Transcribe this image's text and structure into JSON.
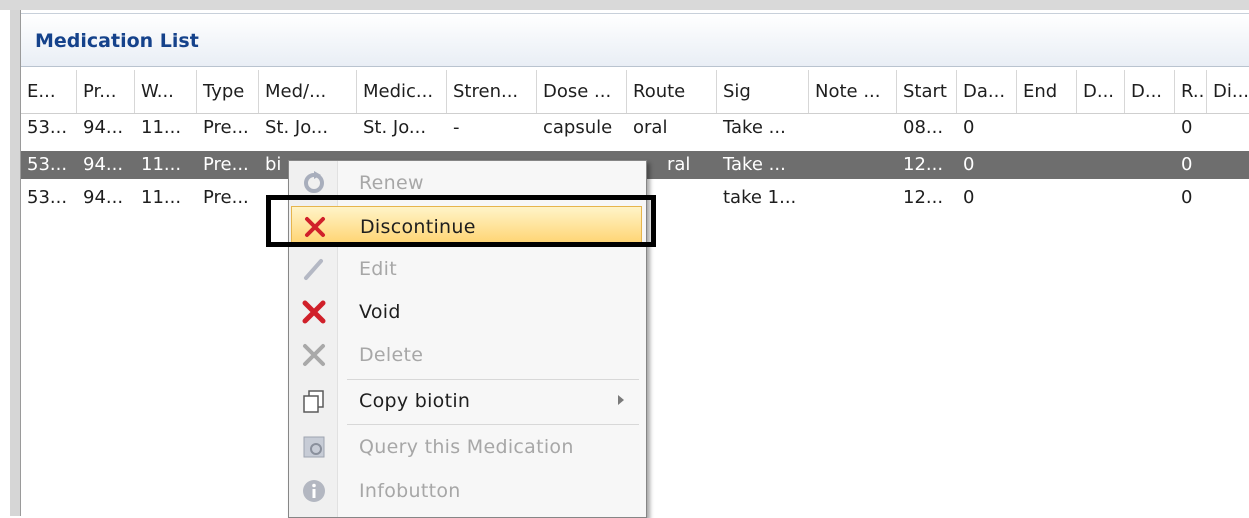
{
  "panel": {
    "title": "Medication List"
  },
  "columns": [
    "E...",
    "Pr...",
    "W...",
    "Type",
    "Med/...",
    "Medic...",
    "Stren...",
    "Dose ...",
    "Route",
    "Sig",
    "Note ...",
    "Start",
    "Da...",
    "End",
    "D...",
    "D...",
    "R..",
    "Di..."
  ],
  "rows": [
    [
      "53...",
      "94...",
      "11...",
      "Pre...",
      "St. Jo...",
      "St. Jo...",
      "-",
      "capsule",
      "oral",
      "Take ...",
      "",
      "08...",
      "0",
      "",
      "",
      "",
      "0",
      ""
    ],
    [
      "53...",
      "94...",
      "11...",
      "Pre...",
      "bi",
      "",
      "",
      "",
      "ral",
      "Take ...",
      "",
      "12...",
      "0",
      "",
      "",
      "",
      "0",
      ""
    ],
    [
      "53...",
      "94...",
      "11...",
      "Pre...",
      "",
      "",
      "",
      "",
      "",
      "take 1...",
      "",
      "12...",
      "0",
      "",
      "",
      "",
      "0",
      ""
    ]
  ],
  "selected_row_index": 1,
  "context_menu": {
    "items": [
      {
        "label": "Renew",
        "icon": "renew-icon",
        "enabled": false
      },
      {
        "label": "Discontinue",
        "icon": "discontinue-x-icon",
        "enabled": true,
        "highlighted": true
      },
      {
        "label": "Edit",
        "icon": "edit-pencil-icon",
        "enabled": false
      },
      {
        "label": "Void",
        "icon": "void-x-icon",
        "enabled": true
      },
      {
        "label": "Delete",
        "icon": "delete-x-icon",
        "enabled": false
      },
      {
        "label": "Copy biotin",
        "icon": "copy-icon",
        "enabled": true,
        "submenu": true
      },
      {
        "label": "Query this Medication",
        "icon": "query-icon",
        "enabled": false
      },
      {
        "label": "Infobutton",
        "icon": "info-icon",
        "enabled": false
      }
    ]
  },
  "colors": {
    "title": "#15428b",
    "selected_row": "#6e6e6e",
    "highlight": "#ffd36f",
    "red_x": "#d0202a"
  }
}
